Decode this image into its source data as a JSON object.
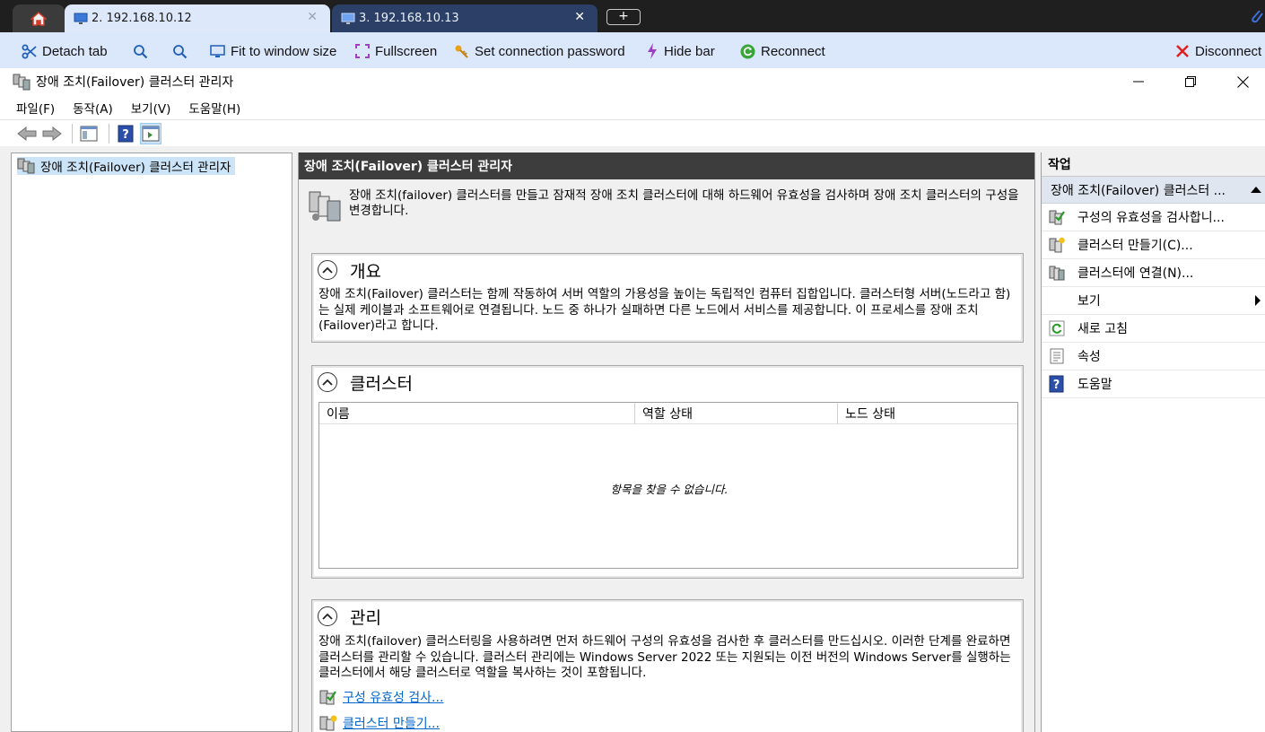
{
  "tabs": [
    {
      "label": "2. 192.168.10.12",
      "active": true
    },
    {
      "label": "3. 192.168.10.13",
      "active": false
    }
  ],
  "new_tab_label": "+",
  "toolbar": {
    "detach_tab": "Detach tab",
    "fit_to_window": "Fit to window size",
    "fullscreen": "Fullscreen",
    "set_password": "Set connection password",
    "hide_bar": "Hide bar",
    "reconnect": "Reconnect",
    "disconnect": "Disconnect"
  },
  "window": {
    "title": "장애 조치(Failover) 클러스터 관리자"
  },
  "menu": {
    "items": [
      "파일(F)",
      "동작(A)",
      "보기(V)",
      "도움말(H)"
    ]
  },
  "tree": {
    "root": "장애 조치(Failover) 클러스터 관리자"
  },
  "center": {
    "header": "장애 조치(Failover) 클러스터 관리자",
    "description": "장애 조치(failover) 클러스터를 만들고 잠재적 장애 조치 클러스터에 대해 하드웨어 유효성을 검사하며 장애 조치 클러스터의 구성을 변경합니다.",
    "overview": {
      "title": "개요",
      "body": "장애 조치(Failover) 클러스터는 함께 작동하여 서버 역할의 가용성을 높이는 독립적인 컴퓨터 집합입니다. 클러스터형 서버(노드라고 함)는 실제 케이블과 소프트웨어로 연결됩니다. 노드 중 하나가 실패하면 다른 노드에서 서비스를 제공합니다. 이 프로세스를 장애 조치(Failover)라고 합니다."
    },
    "clusters": {
      "title": "클러스터",
      "columns": [
        "이름",
        "역할 상태",
        "노드 상태"
      ],
      "empty_message": "항목을 찾을 수 없습니다."
    },
    "management": {
      "title": "관리",
      "body": "장애 조치(failover) 클러스터링을 사용하려면 먼저 하드웨어 구성의 유효성을 검사한 후 클러스터를 만드십시오. 이러한 단계를 완료하면 클러스터를 관리할 수 있습니다. 클러스터 관리에는 Windows Server 2022 또는 지원되는 이전 버전의 Windows Server를 실행하는 클러스터에서 해당 클러스터로 역할을 복사하는 것이 포함됩니다.",
      "links": [
        "구성 유효성 검사...",
        "클러스터 만들기..."
      ]
    }
  },
  "actions": {
    "title": "작업",
    "group": "장애 조치(Failover) 클러스터 ...",
    "items": [
      {
        "label": "구성의 유효성을 검사합니...",
        "icon": "validate-icon"
      },
      {
        "label": "클러스터 만들기(C)...",
        "icon": "create-cluster-icon"
      },
      {
        "label": "클러스터에 연결(N)...",
        "icon": "connect-cluster-icon"
      },
      {
        "label": "보기",
        "icon": "none"
      },
      {
        "label": "새로 고침",
        "icon": "refresh-icon"
      },
      {
        "label": "속성",
        "icon": "properties-icon"
      },
      {
        "label": "도움말",
        "icon": "help-icon"
      }
    ]
  }
}
